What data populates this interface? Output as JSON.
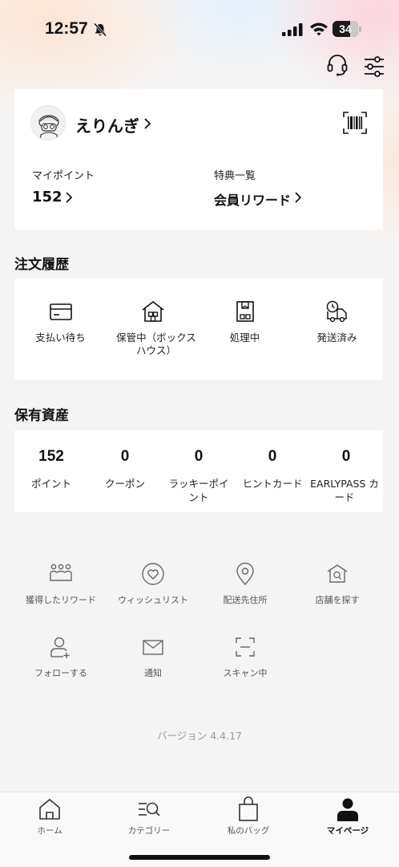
{
  "status_bar": {
    "time": "12:57",
    "battery": "34"
  },
  "header": {
    "support_icon": "headset-icon",
    "settings_icon": "sliders-icon"
  },
  "profile": {
    "username": "えりんぎ",
    "points_label": "マイポイント",
    "points_value": "152",
    "benefits_label": "特典一覧",
    "benefits_value": "会員リワード"
  },
  "orders": {
    "title": "注文履歴",
    "items": [
      {
        "label": "支払い待ち",
        "icon": "wallet-icon"
      },
      {
        "label": "保管中（ボックスハウス）",
        "icon": "warehouse-icon"
      },
      {
        "label": "処理中",
        "icon": "package-icon"
      },
      {
        "label": "発送済み",
        "icon": "delivery-truck-icon"
      }
    ]
  },
  "assets": {
    "title": "保有資産",
    "items": [
      {
        "value": "152",
        "label": "ポイント"
      },
      {
        "value": "0",
        "label": "クーポン"
      },
      {
        "value": "0",
        "label": "ラッキーポイント"
      },
      {
        "value": "0",
        "label": "ヒントカード"
      },
      {
        "value": "0",
        "label": "EARLYPASS カード"
      }
    ]
  },
  "menu": [
    {
      "label": "獲得したリワード",
      "icon": "rewards-icon"
    },
    {
      "label": "ウィッシュリスト",
      "icon": "heart-icon"
    },
    {
      "label": "配送先住所",
      "icon": "location-pin-icon"
    },
    {
      "label": "店舗を探す",
      "icon": "store-search-icon"
    },
    {
      "label": "フォローする",
      "icon": "follow-user-icon"
    },
    {
      "label": "通知",
      "icon": "envelope-icon"
    },
    {
      "label": "スキャン中",
      "icon": "scan-icon"
    }
  ],
  "version": "バージョン 4.4.17",
  "tabs": [
    {
      "label": "ホーム",
      "icon": "home-icon"
    },
    {
      "label": "カテゴリー",
      "icon": "category-search-icon"
    },
    {
      "label": "私のバッグ",
      "icon": "shopping-bag-icon"
    },
    {
      "label": "マイページ",
      "icon": "profile-icon",
      "active": true
    }
  ]
}
